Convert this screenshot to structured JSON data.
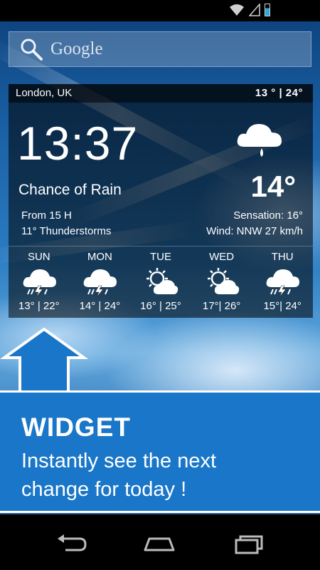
{
  "search": {
    "placeholder": "Google",
    "icon": "search-icon"
  },
  "widget": {
    "location": "London, UK",
    "range": "13 ° |  24°",
    "time": "13:37",
    "condition": "Chance of Rain",
    "from": "From 15 H",
    "storms": "11° Thunderstorms",
    "current_icon": "rain-cloud-icon",
    "temperature": "14°",
    "sensation": "Sensation: 16°",
    "wind": "Wind: NNW 27 km/h",
    "forecast": [
      {
        "day": "SUN",
        "icon": "thunderstorm-icon",
        "temps": "13° | 22°"
      },
      {
        "day": "MON",
        "icon": "thunderstorm-icon",
        "temps": "14° | 24°"
      },
      {
        "day": "TUE",
        "icon": "partly-cloudy-icon",
        "temps": "16° | 25°"
      },
      {
        "day": "WED",
        "icon": "partly-cloudy-icon",
        "temps": "17°| 26°"
      },
      {
        "day": "THU",
        "icon": "thunderstorm-icon",
        "temps": "15°| 24°"
      }
    ]
  },
  "banner": {
    "title": "WIDGET",
    "line1": "Instantly see the next",
    "line2": "change for today !",
    "color": "#1976c8"
  },
  "nav": {
    "back_icon": "back-icon",
    "home_icon": "home-icon",
    "recents_icon": "recents-icon"
  }
}
